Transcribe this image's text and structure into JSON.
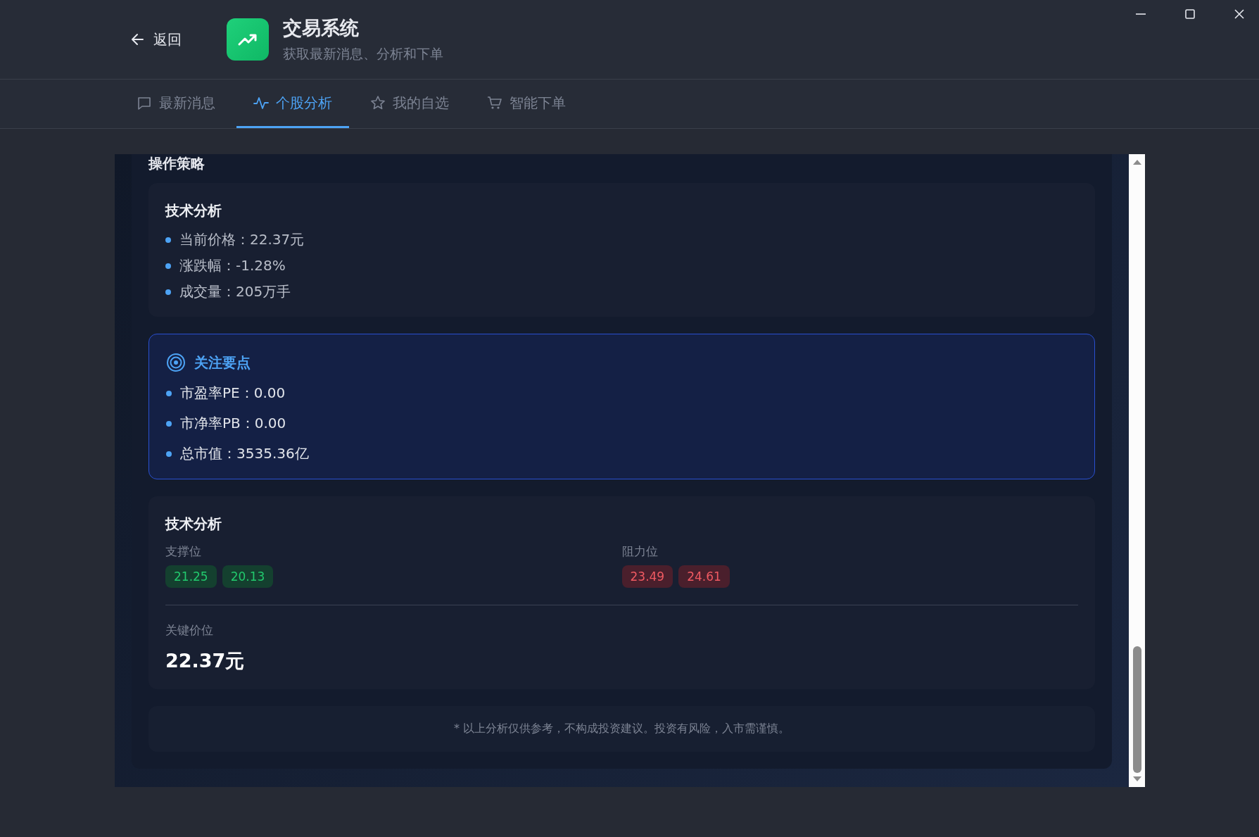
{
  "header": {
    "back_label": "返回",
    "title": "交易系统",
    "subtitle": "获取最新消息、分析和下单"
  },
  "tabs": [
    {
      "label": "最新消息",
      "kind": "message",
      "selected": false
    },
    {
      "label": "个股分析",
      "kind": "pulse",
      "selected": true
    },
    {
      "label": "我的自选",
      "kind": "star",
      "selected": false
    },
    {
      "label": "智能下单",
      "kind": "cart",
      "selected": false
    }
  ],
  "strategy": {
    "title": "操作策略",
    "technical": {
      "title": "技术分析",
      "items": [
        "当前价格：22.37元",
        "涨跌幅：-1.28%",
        "成交量：205万手"
      ]
    },
    "focus": {
      "title": "关注要点",
      "items": [
        "市盈率PE：0.00",
        "市净率PB：0.00",
        "总市值：3535.36亿"
      ]
    },
    "levels": {
      "title": "技术分析",
      "groups": [
        {
          "label": "支撑位",
          "kind": "support",
          "values": [
            "21.25",
            "20.13"
          ]
        },
        {
          "label": "阻力位",
          "kind": "resistance",
          "values": [
            "23.49",
            "24.61"
          ]
        }
      ],
      "key_label": "关键价位",
      "key_value": "22.37元"
    },
    "disclaimer": "* 以上分析仅供参考，不构成投资建议。投资有风险，入市需谨慎。"
  }
}
